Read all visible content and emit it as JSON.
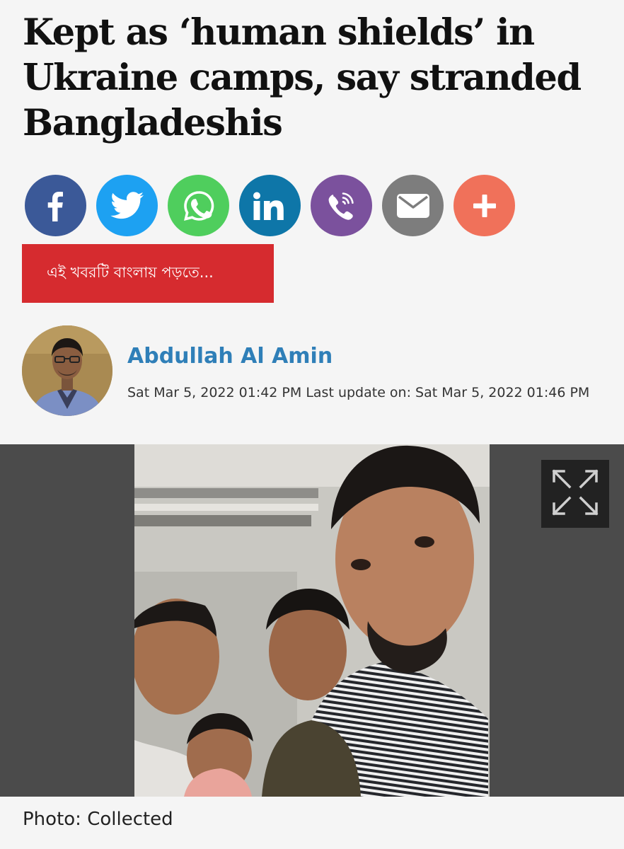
{
  "article": {
    "headline_lines": [
      "Kept as ‘human shields’ in",
      "Ukraine camps, say stranded",
      "Bangladeshis"
    ],
    "read_in_bangla": "এই খবরটি বাংলায় পড়তে...",
    "author": {
      "name": "Abdullah Al Amin",
      "dateline": "Sat Mar 5, 2022 01:42 PM Last update on: Sat Mar 5, 2022 01:46 PM"
    },
    "photo_caption": "Photo: Collected"
  },
  "share": [
    {
      "name": "facebook",
      "icon": "facebook-icon",
      "color": "#3b5998"
    },
    {
      "name": "twitter",
      "icon": "twitter-icon",
      "color": "#1da1f2"
    },
    {
      "name": "whatsapp",
      "icon": "whatsapp-icon",
      "color": "#4fce5d"
    },
    {
      "name": "linkedin",
      "icon": "linkedin-icon",
      "color": "#0e76a8"
    },
    {
      "name": "viber",
      "icon": "viber-icon",
      "color": "#7b519d"
    },
    {
      "name": "email",
      "icon": "mail-icon",
      "color": "#7d7d7d"
    },
    {
      "name": "more",
      "icon": "plus-icon",
      "color": "#f0715a"
    }
  ],
  "colors": {
    "accent_red": "#d62b2f",
    "author_link": "#2f7fb8",
    "media_background": "#4b4b4b"
  },
  "icons": {
    "expand": "expand-icon"
  }
}
